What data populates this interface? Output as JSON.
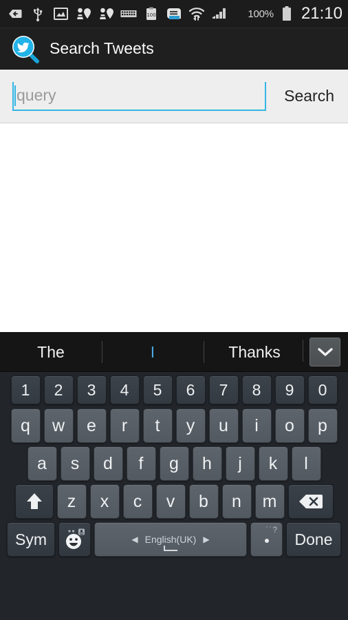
{
  "statusbar": {
    "icons": [
      {
        "name": "download-tag-icon",
        "glyph": "tag-arrow"
      },
      {
        "name": "usb-icon",
        "glyph": "usb"
      },
      {
        "name": "screenshot-image-icon",
        "glyph": "image"
      },
      {
        "name": "person-pin-icon-1",
        "glyph": "person-pin"
      },
      {
        "name": "person-pin-icon-2",
        "glyph": "person-pin"
      },
      {
        "name": "keyboard-icon",
        "glyph": "keyboard"
      },
      {
        "name": "clipboard-100-icon",
        "glyph": "clipboard100"
      },
      {
        "name": "news-document-icon",
        "glyph": "document"
      },
      {
        "name": "wifi-transfer-icon",
        "glyph": "wifi"
      },
      {
        "name": "signal-bars-icon",
        "glyph": "signal"
      }
    ],
    "battery_percent": "100%",
    "time": "21:10"
  },
  "actionbar": {
    "title": "Search Tweets",
    "icon_name": "twitter-search-icon",
    "accent": "#22b3e8"
  },
  "search": {
    "placeholder": "query",
    "value": "",
    "button_label": "Search",
    "underline_color": "#33b5e5"
  },
  "content": {
    "empty": ""
  },
  "keyboard": {
    "suggestions": [
      {
        "text": "The",
        "active": false
      },
      {
        "text": "I",
        "active": true
      },
      {
        "text": "Thanks",
        "active": false
      }
    ],
    "expand_icon": "chevron-down-icon",
    "rows": {
      "numbers": [
        "1",
        "2",
        "3",
        "4",
        "5",
        "6",
        "7",
        "8",
        "9",
        "0"
      ],
      "top": [
        "q",
        "w",
        "e",
        "r",
        "t",
        "y",
        "u",
        "i",
        "o",
        "p"
      ],
      "home": [
        "a",
        "s",
        "d",
        "f",
        "g",
        "h",
        "j",
        "k",
        "l"
      ],
      "bottom": [
        "z",
        "x",
        "c",
        "v",
        "b",
        "n",
        "m"
      ]
    },
    "shift_label": "shift-icon",
    "backspace_label": "backspace-icon",
    "sym_label": "Sym",
    "emoji_label": "emoji-icon",
    "space_language": "English(UK)",
    "space_prev_arrow": "◀",
    "space_next_arrow": "▶",
    "period_hint": "˙˙?",
    "period_label": ".",
    "done_label": "Done"
  }
}
